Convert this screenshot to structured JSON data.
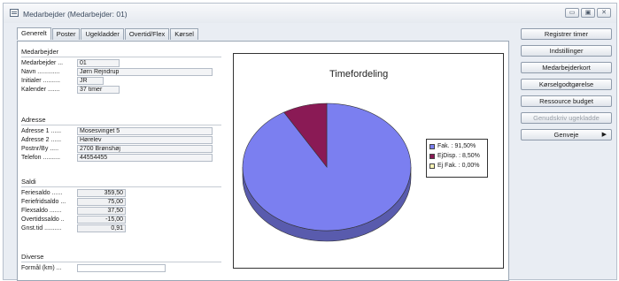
{
  "window": {
    "title": "Medarbejder (Medarbejder: 01)",
    "btn_min": "▭",
    "btn_max": "▣",
    "btn_close": "✕"
  },
  "tabs": [
    {
      "label": "Generelt",
      "active": true
    },
    {
      "label": "Poster",
      "active": false
    },
    {
      "label": "Ugekladder",
      "active": false
    },
    {
      "label": "Overtid/Flex",
      "active": false
    },
    {
      "label": "Kørsel",
      "active": false
    }
  ],
  "medarbejder": {
    "title": "Medarbejder",
    "fields": [
      {
        "label": "Medarbejder ... ",
        "value": "01"
      },
      {
        "label": "Navn .............",
        "value": "Jørn Rejndrup"
      },
      {
        "label": "Initialer ..........",
        "value": "JR"
      },
      {
        "label": "Kalender .......",
        "value": "37 timer"
      }
    ]
  },
  "adresse": {
    "title": "Adresse",
    "fields": [
      {
        "label": "Adresse 1 ......",
        "value": "Mosesvinget 5"
      },
      {
        "label": "Adresse 2 ......",
        "value": "Hørelev"
      },
      {
        "label": "Postnr/By .....",
        "value": "2700 Brønshøj"
      },
      {
        "label": "Telefon ..........",
        "value": "44554455"
      }
    ]
  },
  "saldi": {
    "title": "Saldi",
    "fields": [
      {
        "label": "Feriesaldo ......",
        "value": "359,50"
      },
      {
        "label": "Feriefridsaldo ...",
        "value": "75,00"
      },
      {
        "label": "Flexsaldo .......",
        "value": "37,50"
      },
      {
        "label": "Overtidssaldo ..",
        "value": "-15,00"
      },
      {
        "label": "Gnst.tid ..........",
        "value": "0,91"
      }
    ]
  },
  "diverse": {
    "title": "Diverse",
    "fields": [
      {
        "label": "Formål (km) ...",
        "value": ""
      }
    ]
  },
  "chart_data": {
    "type": "pie",
    "title": "Timefordeling",
    "labels": [
      "Fak.",
      "EjDisp.",
      "Ej Fak."
    ],
    "values": [
      91.5,
      8.5,
      0.0
    ],
    "colors": [
      "#7b7ff0",
      "#8a1a55",
      "#f7f2b5"
    ],
    "legend": [
      {
        "label": "Fak.",
        "value": ": 91,50%"
      },
      {
        "label": "EjDisp.",
        "value": ": 8,50%"
      },
      {
        "label": "Ej Fak.",
        "value": ": 0,00%"
      }
    ],
    "legend_position": "right",
    "style": "3d"
  },
  "actions": [
    {
      "label": "Registrer timer",
      "enabled": true,
      "has_arrow": false
    },
    {
      "label": "Indstillinger",
      "enabled": true,
      "has_arrow": false
    },
    {
      "label": "Medarbejderkort",
      "enabled": true,
      "has_arrow": false
    },
    {
      "label": "Kørselgodtgørelse",
      "enabled": true,
      "has_arrow": false
    },
    {
      "label": "Ressource budget",
      "enabled": true,
      "has_arrow": false
    },
    {
      "label": "Genudskriv ugekladde",
      "enabled": false,
      "has_arrow": false
    },
    {
      "label": "Genveje",
      "enabled": true,
      "has_arrow": true,
      "arrow": "▶"
    }
  ]
}
